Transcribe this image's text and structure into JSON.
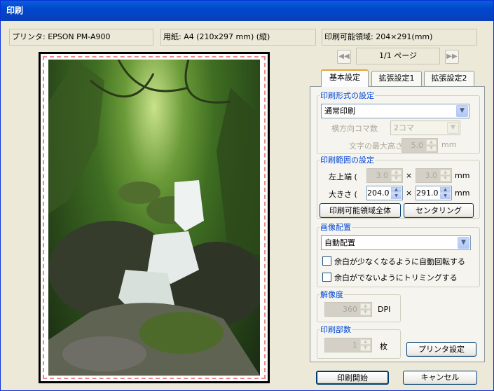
{
  "window": {
    "title": "印刷"
  },
  "info": {
    "printer": "プリンタ: EPSON PM-A900",
    "paper": "用紙: A4 (210x297 mm) (縦)",
    "printable_area": "印刷可能領域: 204×291(mm)"
  },
  "pager": {
    "indicator": "1/1 ページ"
  },
  "tabs": [
    {
      "label": "基本設定",
      "active": true
    },
    {
      "label": "拡張設定1"
    },
    {
      "label": "拡張設定2"
    }
  ],
  "print_format": {
    "legend": "印刷形式の設定",
    "mode": "通常印刷",
    "frames_label": "横方向コマ数",
    "frames_value": "2コマ",
    "max_text_label": "文字の最大高さ",
    "max_text_value": "5.0",
    "max_text_unit": "mm"
  },
  "print_range": {
    "legend": "印刷範囲の設定",
    "top_left_label": "左上端 (",
    "top_left_x": "3.0",
    "top_left_y": "3.0",
    "size_label": "大きさ (",
    "size_w": "204.0",
    "size_h": "291.0",
    "times": "×",
    "unit": "mm",
    "full_area_button": "印刷可能領域全体",
    "center_button": "センタリング"
  },
  "image_layout": {
    "legend": "画像配置",
    "mode": "自動配置",
    "auto_rotate_label": "余白が少なくなるように自動回転する",
    "auto_rotate_checked": false,
    "trim_label": "余白がでないようにトリミングする",
    "trim_checked": false
  },
  "resolution": {
    "legend": "解像度",
    "value": "360",
    "unit": "DPI"
  },
  "copies": {
    "legend": "印刷部数",
    "value": "1",
    "unit": "枚"
  },
  "buttons": {
    "printer_settings": "プリンタ設定",
    "start_print": "印刷開始",
    "cancel": "キャンセル"
  },
  "icons": {
    "prev": "prev-page-icon",
    "next": "next-page-icon",
    "dropdown": "chevron-down-icon"
  },
  "colors": {
    "title_bar": "#0a5fd8",
    "legend_text": "#0046d5",
    "tab_highlight": "#e8a33d"
  }
}
